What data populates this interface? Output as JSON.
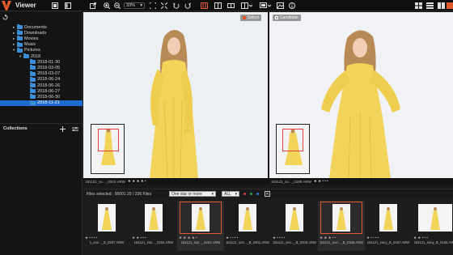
{
  "app": {
    "title": "Viewer",
    "accent": "#e05a2b"
  },
  "toolbar": {
    "zoom": "33%",
    "icons": [
      "sidebar-toggle-icon",
      "filmstrip-icon",
      "export-icon",
      "zoom-in-icon",
      "zoom-out-icon",
      "fit-icon",
      "fullscreen-icon",
      "rotate-left-icon",
      "rotate-right-icon",
      "compare-grid-icon",
      "compare-split-icon",
      "compare-side-icon",
      "layout-icon",
      "display-icon",
      "image-icon",
      "info-icon",
      "grid-view-icon",
      "list-view-icon",
      "compare-view-icon",
      "single-view-icon"
    ]
  },
  "sidebar": {
    "tree": [
      {
        "label": "Documents",
        "level": 1
      },
      {
        "label": "Downloads",
        "level": 1
      },
      {
        "label": "Movies",
        "level": 1
      },
      {
        "label": "Music",
        "level": 1
      },
      {
        "label": "Pictures",
        "level": 1,
        "expanded": true
      },
      {
        "label": "2018",
        "level": 2,
        "expanded": true
      },
      {
        "label": "2018-01-30",
        "level": 3
      },
      {
        "label": "2018-03-05",
        "level": 3
      },
      {
        "label": "2018-03-07",
        "level": 3
      },
      {
        "label": "2018-06-24",
        "level": 3
      },
      {
        "label": "2018-06-26",
        "level": 3
      },
      {
        "label": "2018-06-27",
        "level": 3
      },
      {
        "label": "2018-06-30",
        "level": 3
      },
      {
        "label": "2018-11-21",
        "level": 3,
        "selected": true
      }
    ],
    "collections_label": "Collections"
  },
  "viewer": {
    "left": {
      "tag_label": "Select",
      "filename": "181121_so..._0202.ARW",
      "stars": "★ ★ ★ ★ •"
    },
    "right": {
      "tag_label": "Candidate",
      "filename": "181121_so..._0189.ARW",
      "stars": "★ ★ • • •"
    }
  },
  "filmbar": {
    "files_selected": "Files selected : 00001   20 / 236 Files",
    "rating_filter": "One star or more",
    "label_filter": "ALL",
    "dot_colors": [
      "#d23b3b",
      "#2fa84f",
      "#2f6fd8"
    ]
  },
  "filmstrip": [
    {
      "name": "1_son..._B_0207.ARW",
      "stars": "★ • • • •",
      "selected": false,
      "wide": false
    },
    {
      "name": "181121_son..._0204.ARW",
      "stars": "★ ★ • • •",
      "selected": false,
      "wide": false
    },
    {
      "name": "181121_son..._0202.ARW",
      "stars": "★ ★ ★ ★ •",
      "selected": true,
      "wide": false
    },
    {
      "name": "181121_son..._B_0201.ARW",
      "stars": "★ • • • •",
      "selected": false,
      "wide": false
    },
    {
      "name": "181121_son..._B_0200.ARW",
      "stars": "★ • • • •",
      "selected": false,
      "wide": false
    },
    {
      "name": "181121_son..._B_0189.ARW",
      "stars": "★ ★ ★ • •",
      "selected": true,
      "wide": false
    },
    {
      "name": "181121_sony_B_0167.ARW",
      "stars": "★ • • • •",
      "selected": false,
      "wide": false
    },
    {
      "name": "181121_sony_B_0155.ARW",
      "stars": "★ ★ • • •",
      "selected": false,
      "wide": true
    }
  ]
}
